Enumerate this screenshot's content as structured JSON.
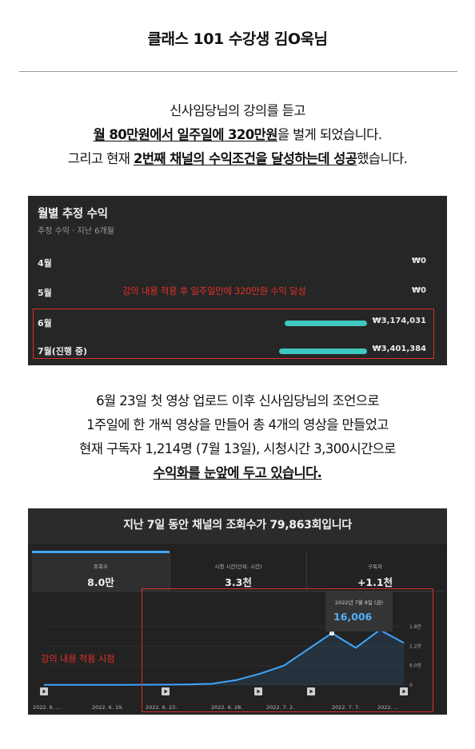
{
  "header": {
    "title": "클래스 101 수강생 김O욱님"
  },
  "intro": {
    "line1": "신사임당님의 강의를 듣고",
    "line2_bold": "월 80만원에서 일주일에 320만원",
    "line2_rest": "을 벌게 되었습니다.",
    "line3_pre": "그리고 현재 ",
    "line3_bold": "2번째 채널의 수익조건을 달성하는데 성공",
    "line3_rest": "했습니다."
  },
  "revenue_panel": {
    "title": "월별 추정 수익",
    "subtitle": "추정 수익 · 지난 6개월",
    "note": "강의 내용 적용 후 일주일만에 320만원 수익 달성",
    "rows": [
      {
        "month": "4월",
        "amount": "₩0"
      },
      {
        "month": "5월",
        "amount": "₩0"
      },
      {
        "month": "6월",
        "amount": "₩3,174,031"
      },
      {
        "month": "7월(진행 중)",
        "amount": "₩3,401,384"
      }
    ]
  },
  "chart_data": [
    {
      "type": "bar",
      "title": "월별 추정 수익",
      "categories": [
        "4월",
        "5월",
        "6월",
        "7월(진행 중)"
      ],
      "values": [
        0,
        0,
        3174031,
        3401384
      ]
    },
    {
      "type": "line",
      "title": "지난 7일 동안 채널의 조회수가 79,863회입니다",
      "x": [
        "2022. 6. ...",
        "2022. 6. 19.",
        "2022. 6. 23.",
        "2022. 6. 28.",
        "2022. 7. 2.",
        "2022. 7. 7.",
        "2022. ..."
      ],
      "series": [
        {
          "values": [
            50,
            50,
            50,
            60,
            80,
            120,
            180,
            400,
            1500,
            3500,
            6000,
            11000,
            16006,
            11500,
            17000,
            13000
          ]
        }
      ],
      "yticks": [
        "0",
        "6.0천",
        "1.2만",
        "1.8만"
      ],
      "ylim": [
        0,
        18000
      ]
    }
  ],
  "outro": {
    "line1": "6월 23일 첫 영상 업로드 이후 신사임당님의 조언으로",
    "line2": "1주일에 한 개씩 영상을 만들어 총 4개의 영상을 만들었고",
    "line3": "현재 구독자 1,214명 (7월 13일), 시청시간 3,300시간으로",
    "line4": "수익화를 눈앞에 두고 있습니다."
  },
  "views_panel": {
    "title": "지난 7일 동안 채널의 조회수가 79,863회입니다",
    "tabs": [
      {
        "label": "조회수",
        "value": "8.0만"
      },
      {
        "label": "시청 시간(단위: 시간)",
        "value": "3.3천"
      },
      {
        "label": "구독자",
        "value": "+1.1천"
      }
    ],
    "tooltip": {
      "date": "2022년 7월 8일 (금)",
      "value": "16,006"
    },
    "note": "강의 내용 적용 시점",
    "markers": 5,
    "colors": {
      "line": "#3ea6ff",
      "highlight": "#d8302a",
      "bar": "#3ec8c0"
    }
  }
}
